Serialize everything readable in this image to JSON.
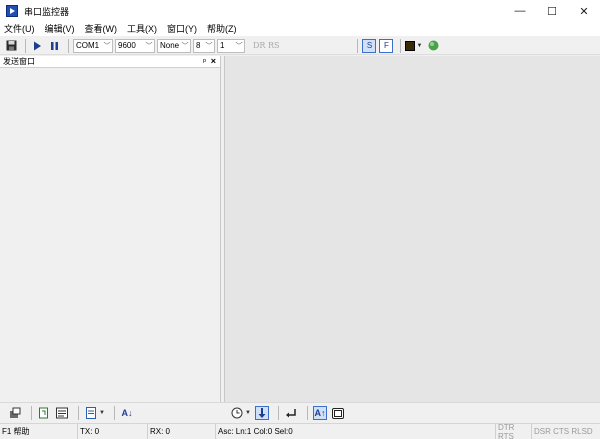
{
  "window": {
    "title": "串口监控器",
    "controls": [
      "—",
      "☐",
      "✕"
    ]
  },
  "menu": [
    "文件(U)",
    "编辑(V)",
    "查看(W)",
    "工具(X)",
    "窗口(Y)",
    "帮助(Z)"
  ],
  "toolbar": {
    "port": "COM1",
    "baud": "9600",
    "parity": "None",
    "databits": "8",
    "stopbits": "1",
    "signals": "DR RS",
    "s_button": "S",
    "f_button": "F"
  },
  "send_pane": {
    "title": "发送窗口",
    "pin": "ᵖ",
    "close": "×"
  },
  "bottom": {
    "sort_label": "A↓",
    "font_label": "A↑"
  },
  "status": {
    "help": "F1 帮助",
    "tx": "TX: 0",
    "rx": "RX: 0",
    "cursor": "Asc: Ln:1  Col:0  Sel:0",
    "dtr_rts": "DTR RTS",
    "dsr_cts": "DSR CTS RLSD"
  }
}
